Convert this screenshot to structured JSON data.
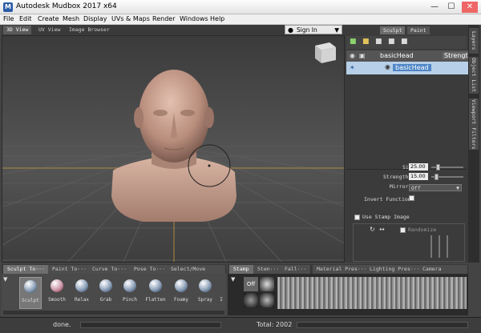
{
  "window": {
    "title": "Autodesk Mudbox 2017 x64",
    "logo_letter": "M",
    "minimize": "—",
    "maximize": "☐",
    "close": "✕"
  },
  "menu": [
    "File",
    "Edit",
    "Create",
    "Mesh",
    "Display",
    "UVs & Maps",
    "Render",
    "Windows",
    "Help"
  ],
  "view_tabs": [
    "3D View",
    "UV View",
    "Image Browser"
  ],
  "sign_in": "Sign In",
  "panel_tabs": [
    "Sculpt",
    "Paint"
  ],
  "side_tabs": [
    "Layers",
    "Object List",
    "Viewport Filters"
  ],
  "layers": {
    "header_name": "basicHead",
    "header_col": "Strength",
    "selected_layer": "basicHead"
  },
  "properties": {
    "size_label": "Size",
    "size_value": "25.00",
    "strength_label": "Strength",
    "strength_value": "15.00",
    "mirror_label": "Mirror",
    "mirror_value": "Off",
    "invert_label": "Invert Function",
    "stamp_label": "Use Stamp Image",
    "randomize_label": "Randomize"
  },
  "tray_tabs_left": [
    "Sculpt To···",
    "Paint To···",
    "Curve To···",
    "Pose To···",
    "Select/Move To···"
  ],
  "tray_tabs_right": [
    "Stamp",
    "Sten···",
    "Fall···",
    "Material Pres···",
    "Lighting Pres···",
    "Camera Bookma···"
  ],
  "tools": [
    "Sculpt",
    "Smooth",
    "Relax",
    "Grab",
    "Pinch",
    "Flatten",
    "Foamy",
    "Spray",
    "I"
  ],
  "stamp_off": "Off",
  "status": {
    "left": "done.",
    "right": "Total: 2002"
  },
  "colors": {
    "grid_line": "#5e5e5e",
    "axis_orange": "#c89a3a",
    "skin": "#c9a393",
    "selection": "#b7cfe8"
  }
}
